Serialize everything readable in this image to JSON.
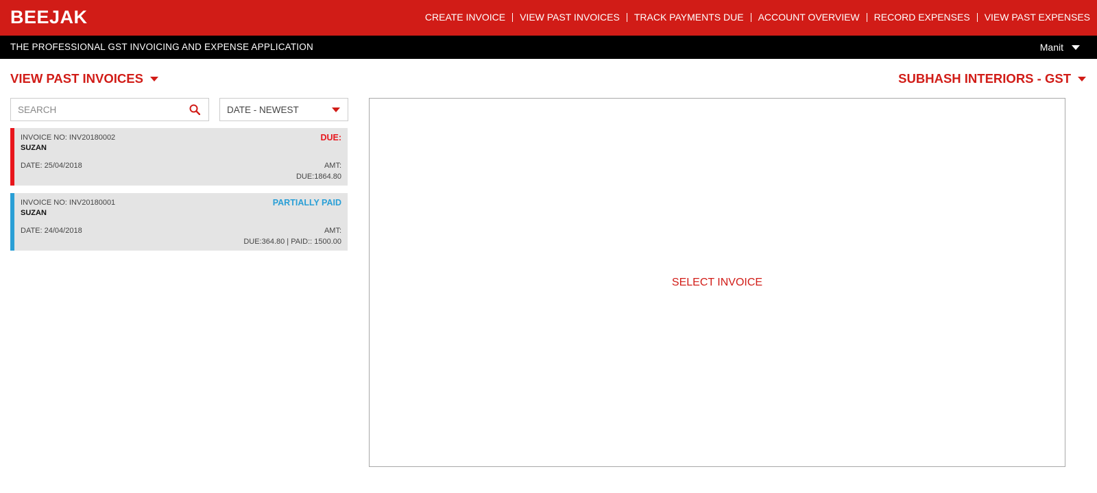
{
  "app": {
    "logo": "BEEJAK"
  },
  "nav": {
    "items": [
      {
        "label": "CREATE INVOICE"
      },
      {
        "label": "VIEW PAST INVOICES"
      },
      {
        "label": "TRACK PAYMENTS DUE"
      },
      {
        "label": "ACCOUNT OVERVIEW"
      },
      {
        "label": "RECORD EXPENSES"
      },
      {
        "label": "VIEW PAST EXPENSES"
      }
    ]
  },
  "subheader": {
    "tagline": "THE PROFESSIONAL GST INVOICING AND EXPENSE APPLICATION",
    "user": "Manit"
  },
  "page": {
    "title": "VIEW PAST INVOICES",
    "company": "SUBHASH INTERIORS - GST"
  },
  "search": {
    "placeholder": "SEARCH",
    "value": ""
  },
  "sort": {
    "selected": "DATE - NEWEST"
  },
  "invoices": [
    {
      "invoice_no": "INVOICE NO: INV20180002",
      "customer": "SUZAN",
      "date": "DATE: 25/04/2018",
      "status": "DUE:",
      "status_color": "#e8161c",
      "amt": "AMT:",
      "due": "DUE:1864.80"
    },
    {
      "invoice_no": "INVOICE NO: INV20180001",
      "customer": "SUZAN",
      "date": "DATE: 24/04/2018",
      "status": "PARTIALLY PAID",
      "status_color": "#2a9fd6",
      "amt": "AMT:",
      "due": "DUE:364.80 | PAID:: 1500.00"
    }
  ],
  "preview": {
    "message": "SELECT INVOICE"
  },
  "colors": {
    "brand_red": "#d11c17",
    "subheader_black": "#000000",
    "card_bg": "#e4e4e4"
  }
}
